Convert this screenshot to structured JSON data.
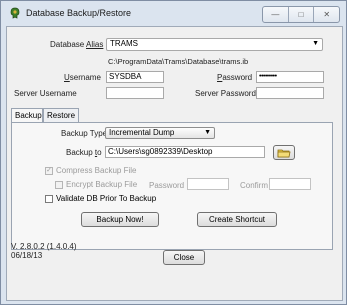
{
  "window": {
    "title": "Database Backup/Restore",
    "controls": {
      "minimize": "—",
      "maximize": "□",
      "close": "✕"
    }
  },
  "connection": {
    "alias_label_pre": "Database ",
    "alias_label_u": "Alias",
    "alias_value": "TRAMS",
    "db_path": "C:\\ProgramData\\Trams\\Database\\trams.ib",
    "username_label_u": "U",
    "username_label_rest": "sername",
    "username_value": "SYSDBA",
    "password_label_u": "P",
    "password_label_rest": "assword",
    "password_value": "•••••••••",
    "server_username_label": "Server Username",
    "server_username_value": "",
    "server_password_label": "Server Password",
    "server_password_value": ""
  },
  "tabs": [
    {
      "label": "Backup",
      "active": true
    },
    {
      "label": "Restore",
      "active": false
    }
  ],
  "backup": {
    "type_label": "Backup Type",
    "type_value": "Incremental Dump",
    "to_label_pre": "Backup ",
    "to_label_u": "t",
    "to_label_post": "o",
    "to_value": "C:\\Users\\sg0892339\\Desktop",
    "compress_label": "Compress Backup File",
    "encrypt_label": "Encrypt Backup File",
    "password_label": "Password",
    "confirm_label": "Confirm",
    "validate_label": "Validate DB Prior To Backup",
    "backup_now_label": "Backup Now!",
    "create_shortcut_label": "Create Shortcut"
  },
  "footer": {
    "version": "V. 2.8.0.2 (1.4.0.4)",
    "date": "06/18/13",
    "close_label": "Close"
  },
  "colors": {
    "frame": "#dbe4ef",
    "client": "#f0f0f0",
    "folder": "#e8c94a"
  }
}
